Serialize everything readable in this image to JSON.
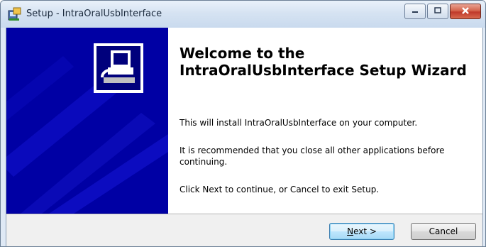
{
  "window": {
    "title": "Setup - IntraOralUsbInterface",
    "minimize_icon": "minimize-icon",
    "maximize_icon": "maximize-icon",
    "close_icon": "close-icon"
  },
  "welcome": {
    "heading": "Welcome to the IntraOralUsbInterface Setup Wizard",
    "paragraph1": "This will install IntraOralUsbInterface on your computer.",
    "paragraph2": "It is recommended that you close all other applications before continuing.",
    "paragraph3": "Click Next to continue, or Cancel to exit Setup."
  },
  "buttons": {
    "next_mnemonic": "N",
    "next_rest": "ext >",
    "cancel": "Cancel"
  },
  "colors": {
    "banner": "#0000a4",
    "accent": "#3c7fb1"
  }
}
